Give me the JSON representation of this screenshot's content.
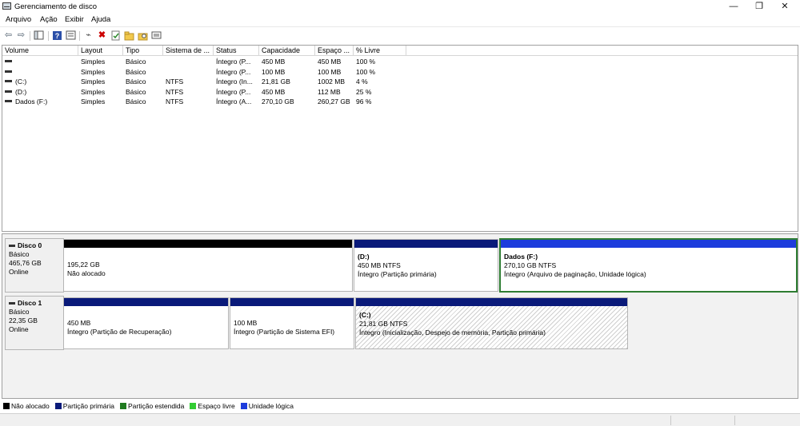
{
  "window": {
    "title": "Gerenciamento de disco",
    "controls": {
      "minimize": "—",
      "restore": "❐",
      "close": "✕"
    }
  },
  "menu": [
    "Arquivo",
    "Ação",
    "Exibir",
    "Ajuda"
  ],
  "toolbar": {
    "icons": [
      "back-arrow-icon",
      "forward-arrow-icon",
      "console-tree-icon",
      "help-icon",
      "properties-icon",
      "connect-icon",
      "delete-icon",
      "check-icon",
      "new-folder-icon",
      "search-folder-icon",
      "view-icon"
    ]
  },
  "volume_table": {
    "columns": [
      "Volume",
      "Layout",
      "Tipo",
      "Sistema de ...",
      "Status",
      "Capacidade",
      "Espaço ...",
      "% Livre"
    ],
    "rows": [
      [
        "",
        "Simples",
        "Básico",
        "",
        "Íntegro (P...",
        "450 MB",
        "450 MB",
        "100 %"
      ],
      [
        "",
        "Simples",
        "Básico",
        "",
        "Íntegro (P...",
        "100 MB",
        "100 MB",
        "100 %"
      ],
      [
        "(C:)",
        "Simples",
        "Básico",
        "NTFS",
        "Íntegro (In...",
        "21,81 GB",
        "1002 MB",
        "4 %"
      ],
      [
        "(D:)",
        "Simples",
        "Básico",
        "NTFS",
        "Íntegro (P...",
        "450 MB",
        "112 MB",
        "25 %"
      ],
      [
        "Dados (F:)",
        "Simples",
        "Básico",
        "NTFS",
        "Íntegro (A...",
        "270,10 GB",
        "260,27 GB",
        "96 %"
      ]
    ]
  },
  "disks": [
    {
      "name": "Disco 0",
      "type": "Básico",
      "size": "465,76 GB",
      "status": "Online",
      "partitions": [
        {
          "title": "",
          "line1": "195,22 GB",
          "line2": "Não alocado",
          "color": "#000000"
        },
        {
          "title": "(D:)",
          "line1": "450 MB NTFS",
          "line2": "Íntegro (Partição primária)",
          "color": "#0a1a7a"
        },
        {
          "title": "Dados  (F:)",
          "line1": "270,10 GB NTFS",
          "line2": "Íntegro (Arquivo de paginação, Unidade lógica)",
          "color": "#1d3cdc"
        }
      ]
    },
    {
      "name": "Disco 1",
      "type": "Básico",
      "size": "22,35 GB",
      "status": "Online",
      "partitions": [
        {
          "title": "",
          "line1": "450 MB",
          "line2": "Íntegro (Partição de Recuperação)",
          "color": "#0a1a7a"
        },
        {
          "title": "",
          "line1": "100 MB",
          "line2": "Íntegro (Partição de Sistema EFI)",
          "color": "#0a1a7a"
        },
        {
          "title": "(C:)",
          "line1": "21,81 GB NTFS",
          "line2": "Íntegro (Inicialização, Despejo de memória, Partição primária)",
          "color": "#0a1a7a"
        }
      ]
    }
  ],
  "legend": [
    {
      "label": "Não alocado",
      "color": "#000000"
    },
    {
      "label": "Partição primária",
      "color": "#0a1a7a"
    },
    {
      "label": "Partição estendida",
      "color": "#1f7a1f"
    },
    {
      "label": "Espaço livre",
      "color": "#33cc33"
    },
    {
      "label": "Unidade lógica",
      "color": "#1d3cdc"
    }
  ]
}
